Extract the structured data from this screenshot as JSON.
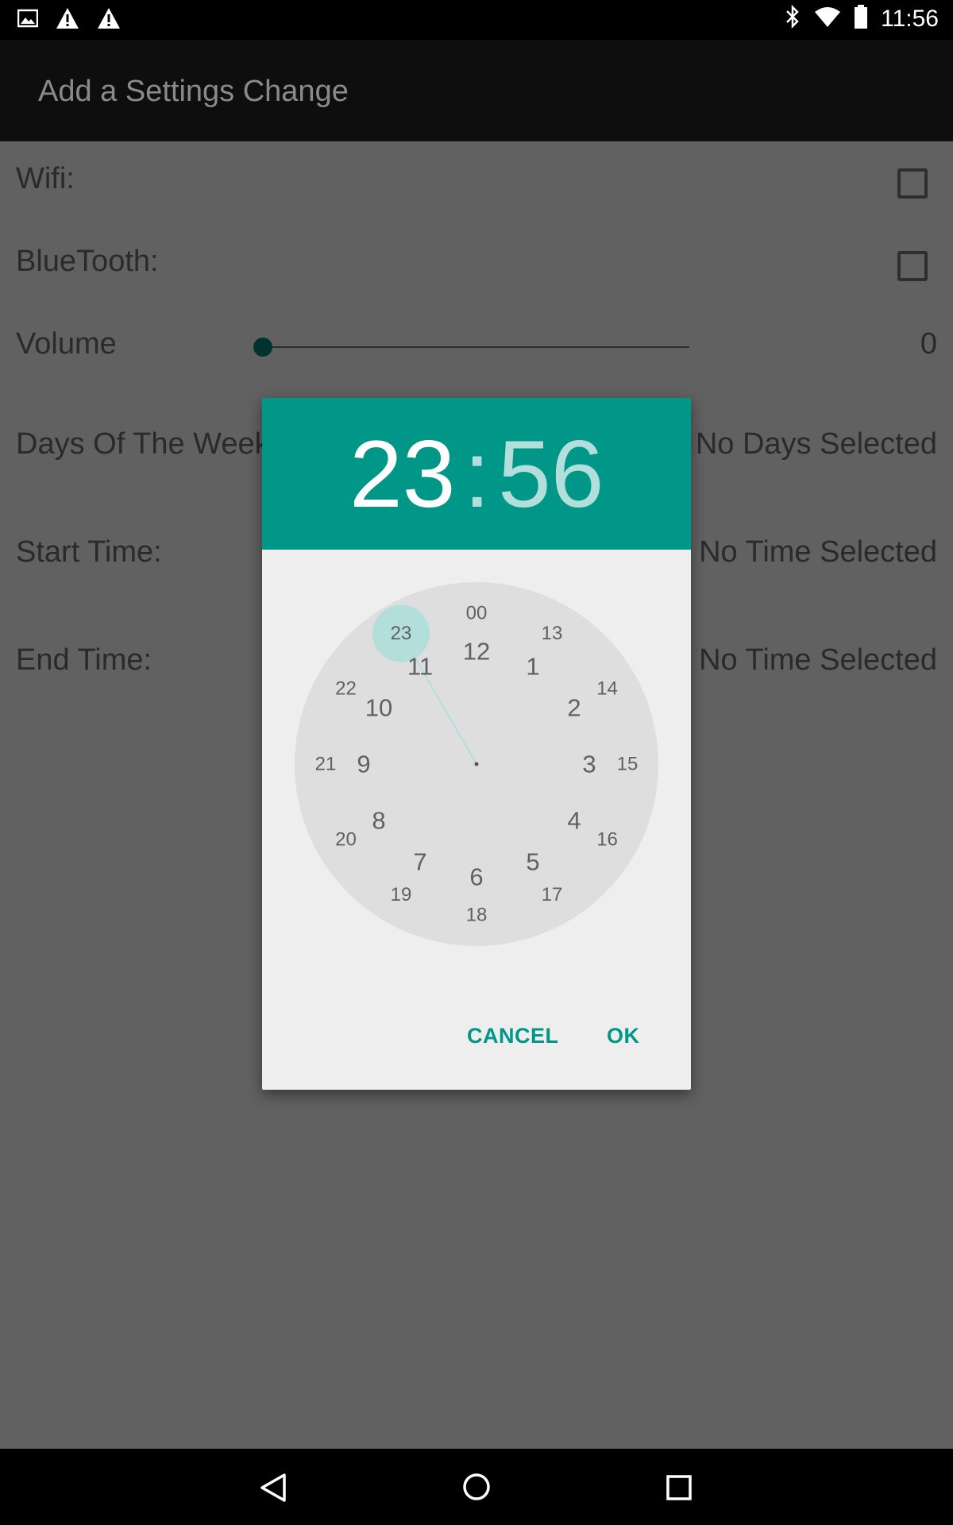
{
  "status_bar": {
    "time": "11:56",
    "left_icons": [
      "image-icon",
      "warning-icon",
      "warning-icon"
    ],
    "right_icons": [
      "bluetooth-icon",
      "wifi-icon",
      "battery-icon"
    ]
  },
  "app_bar": {
    "title": "Add a Settings Change"
  },
  "form": {
    "wifi_label": "Wifi:",
    "bluetooth_label": "BlueTooth:",
    "volume_label": "Volume",
    "volume_value": "0",
    "days_label": "Days Of The Week:",
    "days_value": "No Days Selected",
    "start_label": "Start Time:",
    "start_value": "No Time Selected",
    "end_label": "End Time:",
    "end_value": "No Time Selected"
  },
  "dialog": {
    "hour": "23",
    "separator": ":",
    "minute": "56",
    "selected_hour": "23",
    "outer_numbers": [
      "12",
      "1",
      "2",
      "3",
      "4",
      "5",
      "6",
      "7",
      "8",
      "9",
      "10",
      "11"
    ],
    "inner_numbers": [
      "00",
      "13",
      "14",
      "15",
      "16",
      "17",
      "18",
      "19",
      "20",
      "21",
      "22",
      "23"
    ],
    "cancel_label": "CANCEL",
    "ok_label": "OK"
  },
  "colors": {
    "accent": "#009688",
    "accent_light": "#b2dfdb",
    "dialog_bg": "#eeeeee",
    "clock_face": "#dedede",
    "scrim_page": "#616161"
  },
  "nav_bar": {
    "icons": [
      "back-icon",
      "home-icon",
      "recents-icon"
    ]
  }
}
